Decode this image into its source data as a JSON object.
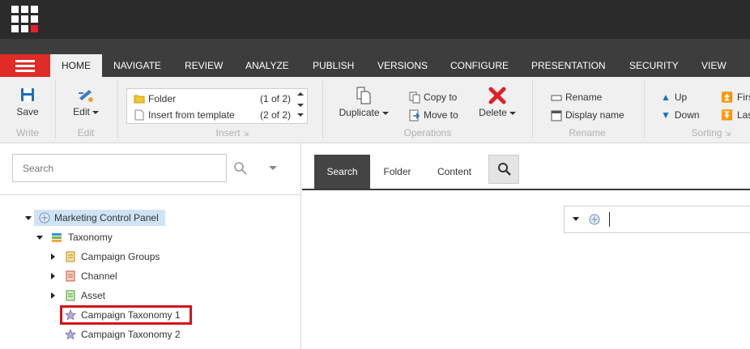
{
  "colors": {
    "accent": "#e02b27",
    "topbar": "#2b2b2b",
    "tabstrip": "#3d3d3d",
    "ribbon": "#f0f0f0",
    "selected": "#cfe3f5",
    "highlight": "#d3141b"
  },
  "apps_icon": "apps-grid-icon",
  "menu_icon": "hamburger-icon",
  "tabs": [
    "HOME",
    "NAVIGATE",
    "REVIEW",
    "ANALYZE",
    "PUBLISH",
    "VERSIONS",
    "CONFIGURE",
    "PRESENTATION",
    "SECURITY",
    "VIEW"
  ],
  "ribbon": {
    "write": {
      "save": "Save",
      "label": "Write"
    },
    "edit": {
      "edit": "Edit",
      "label": "Edit"
    },
    "insert": {
      "items": [
        {
          "label": "Folder",
          "count": "(1 of 2)"
        },
        {
          "label": "Insert from template",
          "count": "(2 of 2)"
        }
      ],
      "label": "Insert"
    },
    "operations": {
      "duplicate": "Duplicate",
      "copy_to": "Copy to",
      "move_to": "Move to",
      "delete": "Delete",
      "label": "Operations"
    },
    "rename": {
      "rename": "Rename",
      "display_name": "Display name",
      "label": "Rename"
    },
    "sorting": {
      "up": "Up",
      "down": "Down",
      "first": "Firs",
      "last": "Las",
      "label": "Sorting"
    }
  },
  "left": {
    "search_placeholder": "Search",
    "tree": [
      {
        "label": "Marketing Control Panel",
        "expanded": true,
        "selected": true
      },
      {
        "label": "Taxonomy",
        "expanded": true
      },
      {
        "label": "Campaign Groups",
        "expanded": false
      },
      {
        "label": "Channel",
        "expanded": false
      },
      {
        "label": "Asset",
        "expanded": false
      },
      {
        "label": "Campaign Taxonomy 1",
        "highlighted": true
      },
      {
        "label": "Campaign Taxonomy 2"
      }
    ]
  },
  "right": {
    "tabs": [
      "Search",
      "Folder",
      "Content"
    ],
    "active_tab": "Search"
  }
}
